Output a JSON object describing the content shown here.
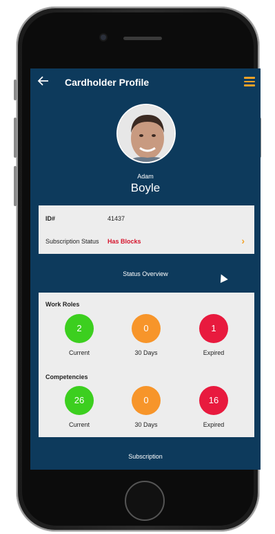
{
  "header": {
    "title": "Cardholder Profile"
  },
  "profile": {
    "first_name": "Adam",
    "last_name": "Boyle"
  },
  "info": {
    "id_label": "ID#",
    "id_value": "41437",
    "subscription_label": "Subscription Status",
    "subscription_value": "Has Blocks"
  },
  "status_overview_title": "Status Overview",
  "work_roles": {
    "title": "Work Roles",
    "items": [
      {
        "count": "2",
        "label": "Current",
        "color": "#3ccf1f"
      },
      {
        "count": "0",
        "label": "30 Days",
        "color": "#f7952a"
      },
      {
        "count": "1",
        "label": "Expired",
        "color": "#e81a3e"
      }
    ]
  },
  "competencies": {
    "title": "Competencies",
    "items": [
      {
        "count": "26",
        "label": "Current",
        "color": "#3ccf1f"
      },
      {
        "count": "0",
        "label": "30 Days",
        "color": "#f7952a"
      },
      {
        "count": "16",
        "label": "Expired",
        "color": "#e81a3e"
      }
    ]
  },
  "footer": {
    "subscription_label": "Subscription"
  },
  "colors": {
    "navy": "#0d3a5c",
    "accent": "#f2a227",
    "alert": "#d6132b"
  },
  "icons": [
    "back-arrow-icon",
    "hamburger-menu-icon",
    "chevron-right-icon"
  ]
}
